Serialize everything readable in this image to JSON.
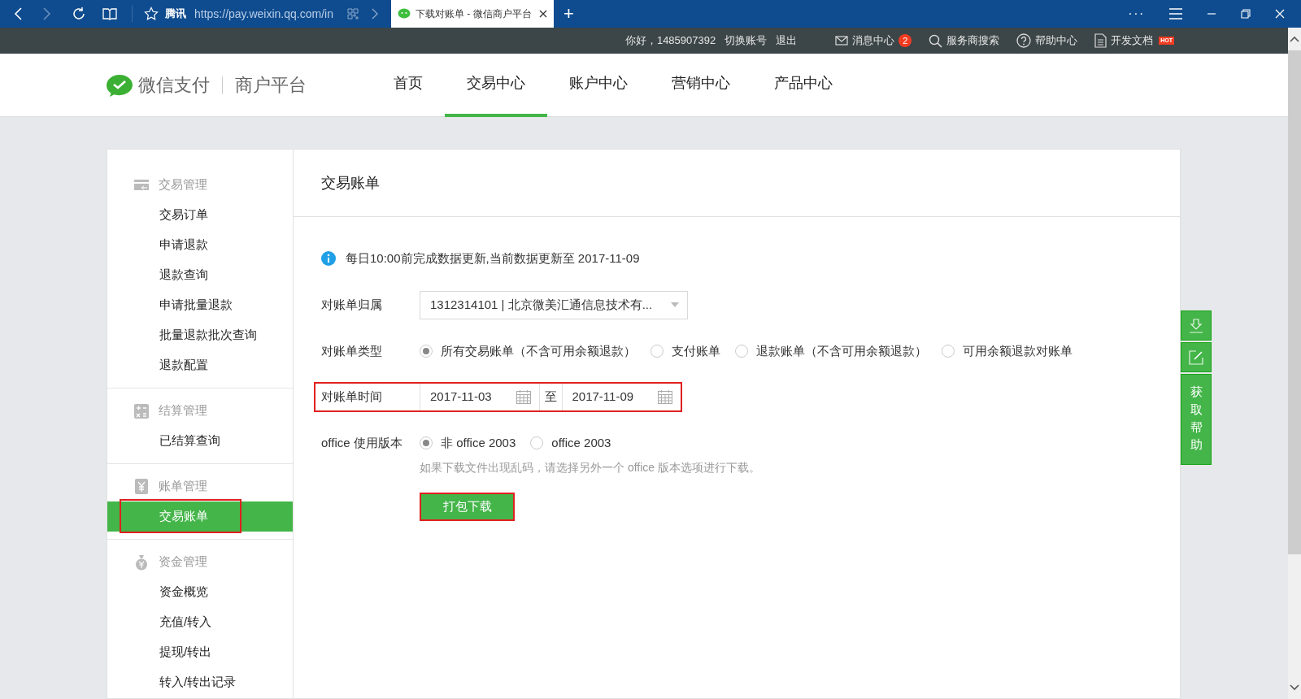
{
  "browser": {
    "site": "腾讯",
    "url": "https://pay.weixin.qq.com/in",
    "tabs": [
      {
        "title": "下载对账单 - 微信商户平台",
        "selected": true
      }
    ],
    "new_tab": "+",
    "menu": "···"
  },
  "top_bar": {
    "greeting": "你好，1485907392",
    "links": [
      "切换账号",
      "退出"
    ],
    "items": [
      {
        "kind": "mail",
        "label": "消息中心",
        "badge": "2"
      },
      {
        "kind": "search",
        "label": "服务商搜索"
      },
      {
        "kind": "help",
        "label": "帮助中心"
      },
      {
        "kind": "doc",
        "label": "开发文档",
        "badge": "HOT"
      }
    ]
  },
  "header": {
    "logo_text": "微信支付",
    "platform": "商户平台",
    "nav": [
      {
        "label": "首页",
        "selected": false
      },
      {
        "label": "交易中心",
        "selected": true
      },
      {
        "label": "账户中心",
        "selected": false
      },
      {
        "label": "营销中心",
        "selected": false
      },
      {
        "label": "产品中心",
        "selected": false
      }
    ]
  },
  "sidebar": {
    "groups": [
      {
        "kind": "trade",
        "title": "交易管理",
        "items": [
          {
            "label": "交易订单",
            "selected": false,
            "highlighted": false
          },
          {
            "label": "申请退款",
            "selected": false,
            "highlighted": false
          },
          {
            "label": "退款查询",
            "selected": false,
            "highlighted": false
          },
          {
            "label": "申请批量退款",
            "selected": false,
            "highlighted": false
          },
          {
            "label": "批量退款批次查询",
            "selected": false,
            "highlighted": false
          },
          {
            "label": "退款配置",
            "selected": false,
            "highlighted": false
          }
        ]
      },
      {
        "kind": "settle",
        "title": "结算管理",
        "items": [
          {
            "label": "已结算查询",
            "selected": false,
            "highlighted": false
          }
        ]
      },
      {
        "kind": "bill",
        "title": "账单管理",
        "items": [
          {
            "label": "交易账单",
            "selected": true,
            "highlighted": true
          }
        ]
      },
      {
        "kind": "fund",
        "title": "资金管理",
        "items": [
          {
            "label": "资金概览",
            "selected": false,
            "highlighted": false
          },
          {
            "label": "充值/转入",
            "selected": false,
            "highlighted": false
          },
          {
            "label": "提现/转出",
            "selected": false,
            "highlighted": false
          },
          {
            "label": "转入/转出记录",
            "selected": false,
            "highlighted": false
          }
        ]
      }
    ]
  },
  "content": {
    "title": "交易账单",
    "notice": "每日10:00前完成数据更新,当前数据更新至 2017-11-09",
    "form": {
      "owner": {
        "label": "对账单归属",
        "value": "1312314101 | 北京微美汇通信息技术有..."
      },
      "type": {
        "label": "对账单类型",
        "options": [
          {
            "label": "所有交易账单（不含可用余额退款）",
            "selected": true
          },
          {
            "label": "支付账单",
            "selected": false
          },
          {
            "label": "退款账单（不含可用余额退款）",
            "selected": false
          },
          {
            "label": "可用余额退款对账单",
            "selected": false
          }
        ]
      },
      "time": {
        "label": "对账单时间",
        "start": "2017-11-03",
        "separator": "至",
        "end": "2017-11-09",
        "highlighted": true
      },
      "office": {
        "label": "office 使用版本",
        "options": [
          {
            "label": "非 office 2003",
            "selected": true
          },
          {
            "label": "office 2003",
            "selected": false
          }
        ],
        "hint": "如果下载文件出现乱码，请选择另外一个 office 版本选项进行下载。"
      },
      "submit": {
        "label": "打包下载",
        "highlighted": true
      }
    }
  },
  "float_tools": {
    "help_label": "获取帮助"
  }
}
